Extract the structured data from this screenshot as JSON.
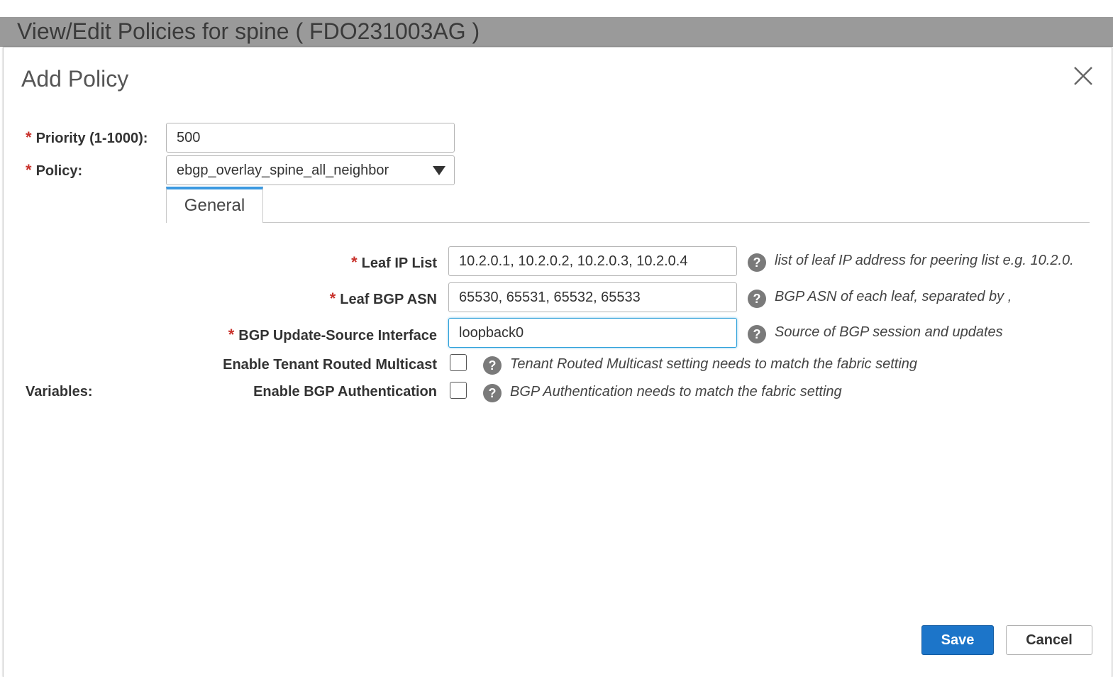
{
  "window": {
    "title": "View/Edit Policies for spine ( FDO231003AG )"
  },
  "modal": {
    "title": "Add Policy",
    "priority": {
      "label": "Priority (1-1000):",
      "value": "500",
      "required": true
    },
    "policy": {
      "label": "Policy:",
      "value": "ebgp_overlay_spine_all_neighbor",
      "required": true
    },
    "tabs": [
      {
        "label": "General",
        "active": true
      }
    ],
    "variables_label": "Variables:",
    "fields": {
      "leaf_ip_list": {
        "label": "Leaf IP List",
        "value": "10.2.0.1, 10.2.0.2, 10.2.0.3, 10.2.0.4",
        "hint": "list of leaf IP address for peering list e.g. 10.2.0.",
        "required": true
      },
      "leaf_bgp_asn": {
        "label": "Leaf BGP ASN",
        "value": "65530, 65531, 65532, 65533",
        "hint": "BGP ASN of each leaf, separated by ,",
        "required": true
      },
      "bgp_update_source": {
        "label": "BGP Update-Source Interface",
        "value": "loopback0",
        "hint": "Source of BGP session and updates",
        "required": true
      },
      "tenant_routed_multicast": {
        "label": "Enable Tenant Routed Multicast",
        "checked": false,
        "hint": "Tenant Routed Multicast setting needs to match the fabric setting"
      },
      "bgp_authentication": {
        "label": "Enable BGP Authentication",
        "checked": false,
        "hint": "BGP Authentication needs to match the fabric setting"
      }
    },
    "buttons": {
      "save": "Save",
      "cancel": "Cancel"
    },
    "required_marker": "*",
    "help_glyph": "?"
  },
  "colors": {
    "primary_button": "#1c75c9",
    "required_marker": "#c8302a",
    "tab_accent": "#3b99e0",
    "title_bar": "#9a9a9a",
    "focus_border": "#2b9fd9"
  },
  "icons": {
    "close": "close-icon",
    "help": "help-icon",
    "dropdown": "caret-down-icon"
  }
}
